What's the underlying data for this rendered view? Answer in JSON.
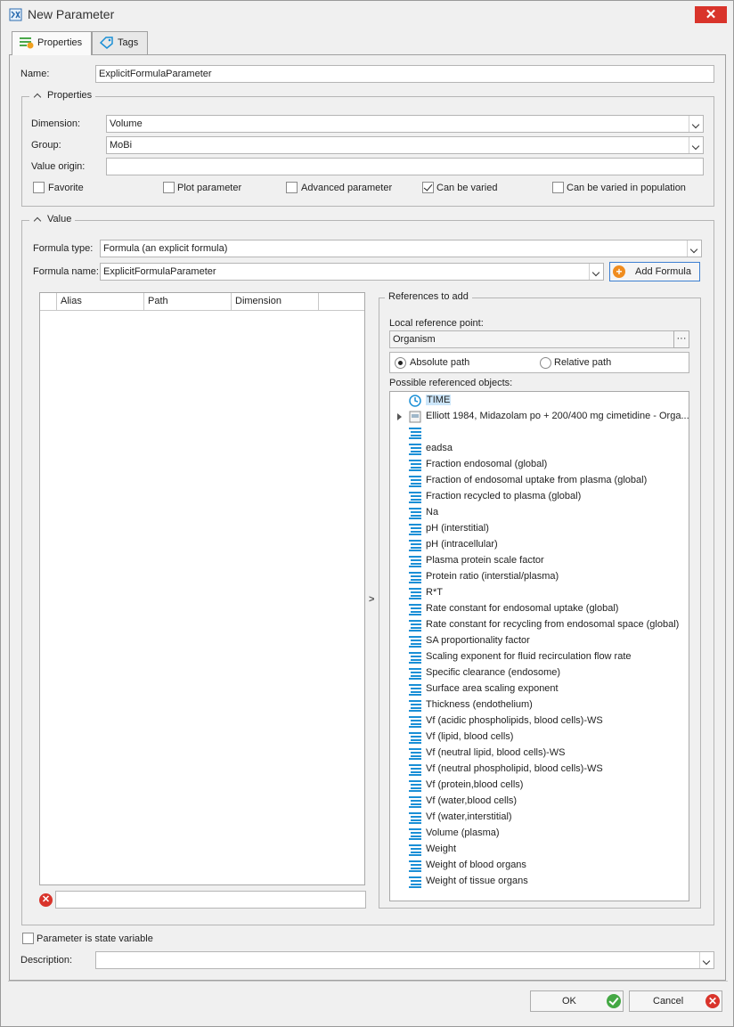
{
  "window": {
    "title": "New Parameter",
    "close": "✕"
  },
  "tabs": [
    {
      "label": "Properties"
    },
    {
      "label": "Tags"
    }
  ],
  "name": {
    "label": "Name:",
    "value": "ExplicitFormulaParameter"
  },
  "properties": {
    "title": "Properties",
    "dimension": {
      "label": "Dimension:",
      "value": "Volume"
    },
    "group": {
      "label": "Group:",
      "value": "MoBi"
    },
    "value_origin": {
      "label": "Value origin:",
      "value": ""
    },
    "checks": {
      "favorite": {
        "label": "Favorite",
        "checked": false
      },
      "plot": {
        "label": "Plot parameter",
        "checked": false
      },
      "advanced": {
        "label": "Advanced parameter",
        "checked": false
      },
      "varied": {
        "label": "Can be varied",
        "checked": true
      },
      "population": {
        "label": "Can be varied in population",
        "checked": false
      }
    }
  },
  "value": {
    "title": "Value",
    "formula_type": {
      "label": "Formula type:",
      "value": "Formula (an explicit formula)"
    },
    "formula_name": {
      "label": "Formula name:",
      "value": "ExplicitFormulaParameter"
    },
    "add_formula": "Add Formula",
    "columns": {
      "alias": "Alias",
      "path": "Path",
      "dimension": "Dimension"
    },
    "formula_text": "",
    "move_arrow": ">"
  },
  "references": {
    "title": "References to add",
    "local_label": "Local reference point:",
    "local_value": "Organism",
    "browse": "···",
    "absolute": "Absolute path",
    "relative": "Relative path",
    "possible_label": "Possible referenced objects:",
    "items": [
      "TIME",
      "Elliott 1984, Midazolam po + 200/400 mg cimetidine - Orga...",
      "",
      "eadsa",
      "Fraction endosomal (global)",
      "Fraction of endosomal uptake from plasma (global)",
      "Fraction recycled to plasma (global)",
      "Na",
      "pH (interstitial)",
      "pH (intracellular)",
      "Plasma protein scale factor",
      "Protein ratio (interstial/plasma)",
      "R*T",
      "Rate constant for endosomal uptake (global)",
      "Rate constant for recycling from endosomal space (global)",
      "SA proportionality factor",
      "Scaling exponent for fluid recirculation flow rate",
      "Specific clearance (endosome)",
      "Surface area scaling exponent",
      "Thickness (endothelium)",
      "Vf (acidic phospholipids, blood cells)-WS",
      "Vf (lipid, blood cells)",
      "Vf (neutral lipid, blood cells)-WS",
      "Vf (neutral phospholipid, blood cells)-WS",
      "Vf (protein,blood cells)",
      "Vf (water,blood cells)",
      "Vf (water,interstitial)",
      "Volume (plasma)",
      "Weight",
      "Weight of blood organs",
      "Weight of tissue organs"
    ]
  },
  "state_variable": {
    "label": "Parameter is state variable",
    "checked": false
  },
  "description": {
    "label": "Description:",
    "value": ""
  },
  "footer": {
    "ok": "OK",
    "cancel": "Cancel"
  },
  "colors": {
    "accent": "#1a8fd6",
    "close": "#d9342b",
    "ok": "#44a844",
    "highlight": "#cce6fa"
  }
}
